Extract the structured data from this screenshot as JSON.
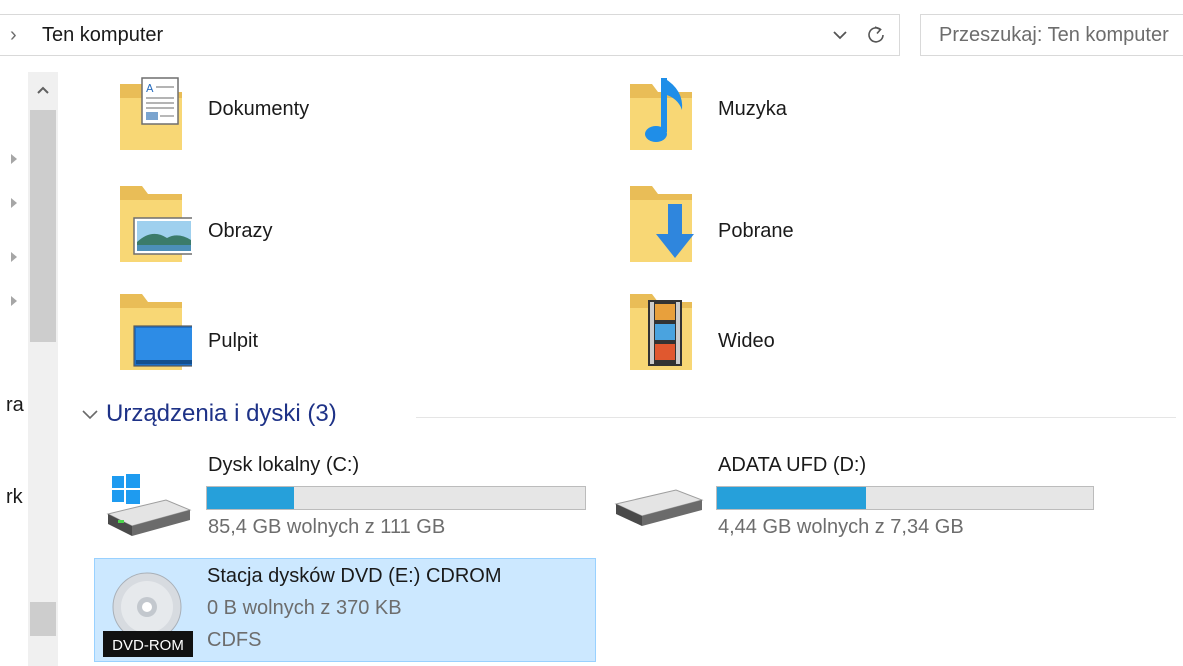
{
  "address_bar": {
    "path": "Ten komputer",
    "search_placeholder": "Przeszukaj: Ten komputer"
  },
  "nav_pane": {
    "fragments": [
      "ra",
      "rk"
    ]
  },
  "folders": [
    {
      "label": "Dokumenty",
      "icon": "documents-folder-icon"
    },
    {
      "label": "Muzyka",
      "icon": "music-folder-icon"
    },
    {
      "label": "Obrazy",
      "icon": "pictures-folder-icon"
    },
    {
      "label": "Pobrane",
      "icon": "downloads-folder-icon"
    },
    {
      "label": "Pulpit",
      "icon": "desktop-folder-icon"
    },
    {
      "label": "Wideo",
      "icon": "videos-folder-icon"
    }
  ],
  "devices_group": {
    "title": "Urządzenia i dyski (3)"
  },
  "drives": [
    {
      "name": "Dysk lokalny (C:)",
      "free_text": "85,4 GB wolnych z 111 GB",
      "used_fraction": 0.23,
      "icon": "windows-drive-icon"
    },
    {
      "name": "ADATA UFD (D:)",
      "free_text": "4,44 GB wolnych z 7,34 GB",
      "used_fraction": 0.395,
      "icon": "usb-drive-icon"
    },
    {
      "name": "Stacja dysków DVD (E:) CDROM",
      "free_text": "0 B wolnych z 370 KB",
      "filesystem": "CDFS",
      "badge": "DVD-ROM",
      "icon": "dvd-drive-icon",
      "selected": true
    }
  ],
  "colors": {
    "accent_bar": "#26a0da",
    "selection_bg": "#cce8ff",
    "group_title": "#1e3287"
  }
}
